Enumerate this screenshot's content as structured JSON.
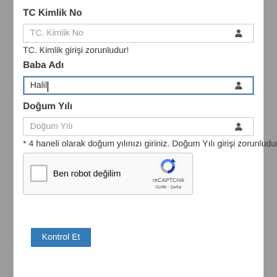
{
  "form": {
    "tc": {
      "label": "TC Kimlik No",
      "placeholder": "TC. Kimlik No",
      "value": "",
      "hint": "TC. Kimlik girişi zorunludur!"
    },
    "father": {
      "label": "Baba Adı",
      "placeholder": "",
      "value": "Halil"
    },
    "birth": {
      "label": "Doğum Yılı",
      "placeholder": "Doğum Yılı",
      "value": "",
      "hint": "* 4 haneli olarak doğum yılınızı giriniz. Doğum Yılı girişi zorunludur!"
    },
    "recaptcha": {
      "checkbox_label": "Ben robot değilim",
      "brand": "reCAPTCHA",
      "terms": "Gizlilik - Şartlar"
    },
    "submit_label": "Kontrol Et"
  },
  "icons": {
    "field_icon": "user-icon",
    "recaptcha_logo": "recaptcha-logo-icon"
  },
  "colors": {
    "button": "#337ab7",
    "focus_border": "#6a8fb3",
    "backdrop": "#9b9b9b"
  }
}
